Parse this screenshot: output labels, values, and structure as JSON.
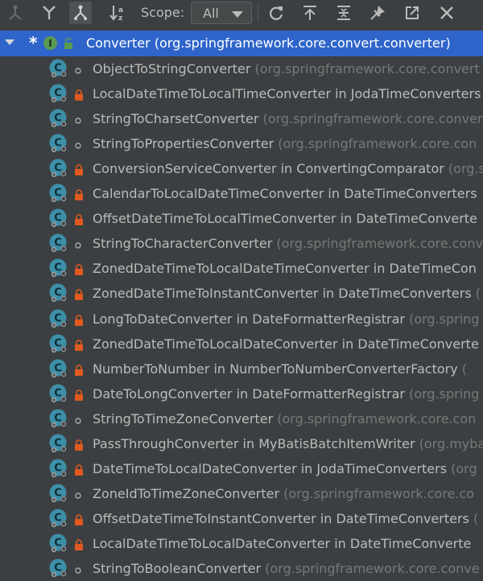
{
  "toolbar": {
    "scope_label": "Scope:",
    "scope_value": "All",
    "buttons": [
      "supertypes-hierarchy-icon",
      "subtypes-hierarchy-icon",
      "class-hierarchy-icon",
      "sort-alphabetically-icon",
      "refresh-icon",
      "export-icon",
      "expand-all-icon",
      "pin-icon",
      "open-in-window-icon",
      "close-icon"
    ]
  },
  "tree": {
    "root": {
      "label": "Converter (org.springframework.core.convert.converter)",
      "icon": "interface-icon"
    },
    "items": [
      {
        "name": "ObjectToStringConverter",
        "context": " (org.springframework.core.convert",
        "visibility": "package-private"
      },
      {
        "name": "LocalDateTimeToLocalTimeConverter in JodaTimeConverters",
        "context": "",
        "visibility": "private"
      },
      {
        "name": "StringToCharsetConverter",
        "context": " (org.springframework.core.conver",
        "visibility": "package-private"
      },
      {
        "name": "StringToPropertiesConverter",
        "context": " (org.springframework.core.con",
        "visibility": "package-private"
      },
      {
        "name": "ConversionServiceConverter in ConvertingComparator",
        "context": " (org.s",
        "visibility": "private"
      },
      {
        "name": "CalendarToLocalDateTimeConverter in DateTimeConverters",
        "context": "",
        "visibility": "private"
      },
      {
        "name": "OffsetDateTimeToLocalTimeConverter in DateTimeConverte",
        "context": "",
        "visibility": "private"
      },
      {
        "name": "StringToCharacterConverter",
        "context": " (org.springframework.core.conv",
        "visibility": "package-private"
      },
      {
        "name": "ZonedDateTimeToLocalDateTimeConverter in DateTimeCon",
        "context": "",
        "visibility": "private"
      },
      {
        "name": "ZonedDateTimeToInstantConverter in DateTimeConverters",
        "context": " (",
        "visibility": "private"
      },
      {
        "name": "LongToDateConverter in DateFormatterRegistrar",
        "context": " (org.spring",
        "visibility": "private"
      },
      {
        "name": "ZonedDateTimeToLocalDateConverter in DateTimeConverte",
        "context": "",
        "visibility": "private"
      },
      {
        "name": "NumberToNumber in NumberToNumberConverterFactory",
        "context": " (",
        "visibility": "private"
      },
      {
        "name": "DateToLongConverter in DateFormatterRegistrar",
        "context": " (org.spring",
        "visibility": "private"
      },
      {
        "name": "StringToTimeZoneConverter",
        "context": " (org.springframework.core.con",
        "visibility": "package-private"
      },
      {
        "name": "PassThroughConverter in MyBatisBatchItemWriter",
        "context": " (org.myba",
        "visibility": "private"
      },
      {
        "name": "DateTimeToLocalDateConverter in JodaTimeConverters",
        "context": " (org",
        "visibility": "private"
      },
      {
        "name": "ZoneIdToTimeZoneConverter",
        "context": " (org.springframework.core.co",
        "visibility": "package-private"
      },
      {
        "name": "OffsetDateTimeToInstantConverter in DateTimeConverters",
        "context": " (",
        "visibility": "private"
      },
      {
        "name": "LocalDateTimeToLocalDateConverter in DateTimeConverte",
        "context": "",
        "visibility": "private"
      },
      {
        "name": "StringToBooleanConverter",
        "context": " (org.springframework.core.conve",
        "visibility": "package-private"
      }
    ]
  },
  "colors": {
    "background": "#3c3f41",
    "selection": "#2f65ca",
    "text": "#bbbbbb",
    "package_text": "#787878",
    "class_icon": "#3d8fa8",
    "lock": "#e05a1f"
  }
}
